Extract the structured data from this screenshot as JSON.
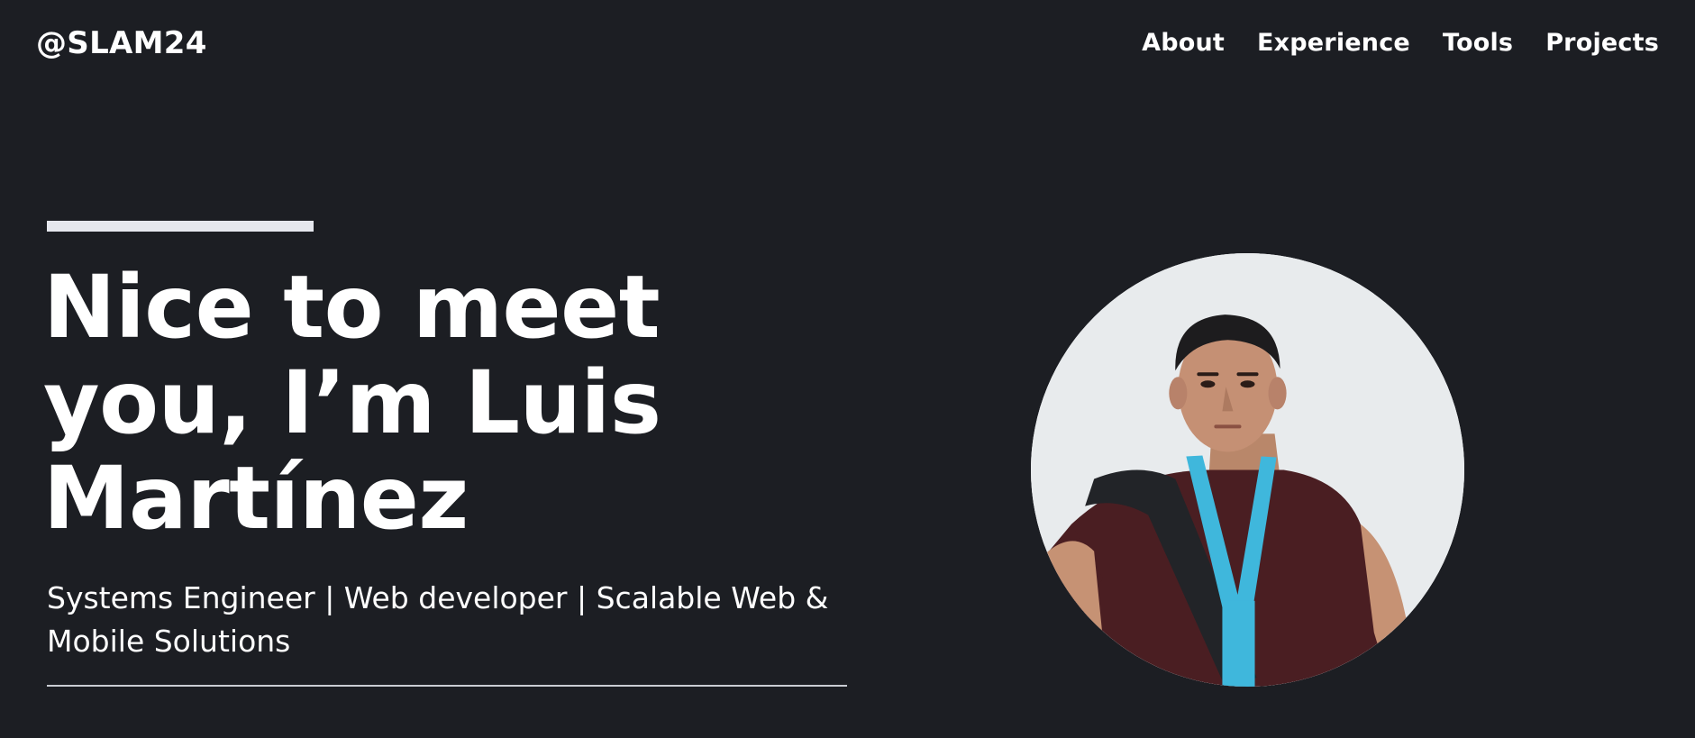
{
  "header": {
    "logo_text": "@SLAM24",
    "nav": [
      {
        "label": "About"
      },
      {
        "label": "Experience"
      },
      {
        "label": "Tools"
      },
      {
        "label": "Projects"
      }
    ]
  },
  "hero": {
    "title_line1": "Nice to meet",
    "title_line2": "you, I’m Luis",
    "title_line3": "Martínez",
    "subtitle_line1": "Systems Engineer | Web developer | Scalable Web &",
    "subtitle_line2": "Mobile Solutions"
  },
  "colors": {
    "background": "#1c1e23",
    "text": "#ffffff",
    "accent_bar": "#e6e8ee",
    "divider": "#c9ccd3"
  }
}
